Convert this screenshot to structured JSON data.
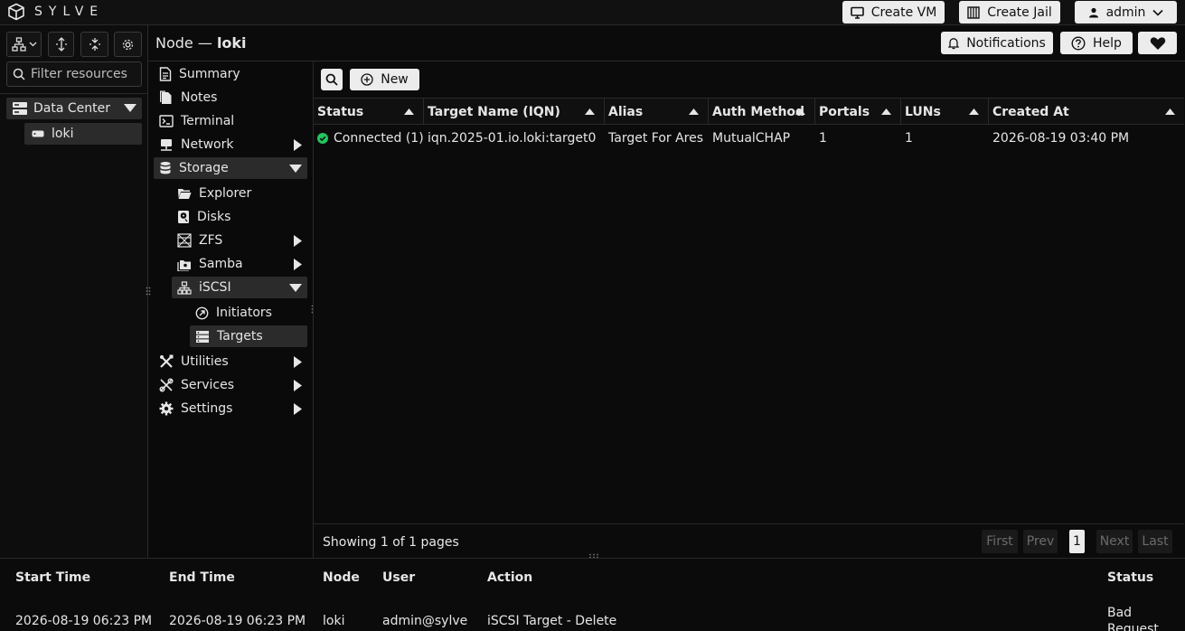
{
  "app": {
    "brand": "SYLVE"
  },
  "topbar": {
    "create_vm": "Create VM",
    "create_jail": "Create Jail",
    "user": "admin"
  },
  "left": {
    "filter_placeholder": "Filter resources",
    "tree": {
      "datacenter": "Data Center",
      "node": "loki"
    }
  },
  "header": {
    "title_prefix": "Node —",
    "title_node": "loki",
    "notifications": "Notifications",
    "help": "Help"
  },
  "nav": {
    "summary": "Summary",
    "notes": "Notes",
    "terminal": "Terminal",
    "network": "Network",
    "storage": "Storage",
    "explorer": "Explorer",
    "disks": "Disks",
    "zfs": "ZFS",
    "samba": "Samba",
    "iscsi": "iSCSI",
    "initiators": "Initiators",
    "targets": "Targets",
    "utilities": "Utilities",
    "services": "Services",
    "settings": "Settings"
  },
  "toolbar": {
    "new_label": "New"
  },
  "table": {
    "columns": [
      "Status",
      "Target Name (IQN)",
      "Alias",
      "Auth Method",
      "Portals",
      "LUNs",
      "Created At"
    ],
    "rows": [
      {
        "status": "Connected (1)",
        "iqn": "iqn.2025-01.io.loki:target0",
        "alias": "Target For Ares",
        "auth": "MutualCHAP",
        "portals": "1",
        "luns": "1",
        "created": "2026-08-19 03:40 PM"
      }
    ]
  },
  "pagination": {
    "summary": "Showing 1 of 1 pages",
    "first": "First",
    "prev": "Prev",
    "page": "1",
    "next": "Next",
    "last": "Last"
  },
  "log": {
    "columns": [
      "Start Time",
      "End Time",
      "Node",
      "User",
      "Action",
      "Status"
    ],
    "rows": [
      {
        "start": "2026-08-19 06:23 PM",
        "end": "2026-08-19 06:23 PM",
        "node": "loki",
        "user": "admin@sylve",
        "action": "iSCSI Target - Delete",
        "status": "Bad Request"
      }
    ]
  },
  "colors": {
    "accent_green": "#22c55e",
    "button_bg": "#ececec",
    "selected_bg": "#2b2b2b"
  }
}
